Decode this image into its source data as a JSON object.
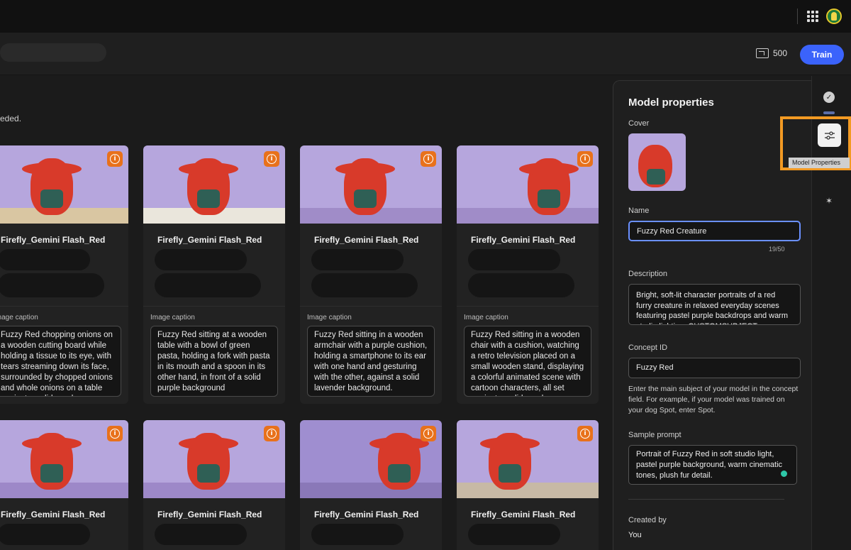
{
  "header": {
    "credits": "500",
    "train_label": "Train"
  },
  "main": {
    "intro_text": "eded.",
    "caption_label": "Image caption",
    "cards": [
      {
        "title": "Firefly_Gemini Flash_Red",
        "caption": "Fuzzy Red chopping onions on a wooden cutting board while holding a tissue to its eye, with tears streaming down its face, surrounded by chopped onions and whole onions on a table against a solid purple background"
      },
      {
        "title": "Firefly_Gemini Flash_Red",
        "caption": "Fuzzy Red sitting at a wooden table with a bowl of green pasta, holding a fork with pasta in its mouth and a spoon in its other hand, in front of a solid purple background"
      },
      {
        "title": "Firefly_Gemini Flash_Red",
        "caption": "Fuzzy Red sitting in a wooden armchair with a purple cushion, holding a smartphone to its ear with one hand and gesturing with the other, against a solid lavender background."
      },
      {
        "title": "Firefly_Gemini Flash_Red",
        "caption": "Fuzzy Red sitting in a wooden chair with a cushion, watching a retro television placed on a small wooden stand, displaying a colorful animated scene with cartoon characters, all set against a solid purple background"
      },
      {
        "title": "Firefly_Gemini Flash_Red",
        "caption": ""
      },
      {
        "title": "Firefly_Gemini Flash_Red",
        "caption": ""
      },
      {
        "title": "Firefly_Gemini Flash_Red",
        "caption": ""
      },
      {
        "title": "Firefly_Gemini Flash_Red",
        "caption": ""
      }
    ]
  },
  "panel": {
    "title": "Model properties",
    "cover_label": "Cover",
    "name_label": "Name",
    "name_value": "Fuzzy Red Creature",
    "name_counter": "19/50",
    "description_label": "Description",
    "description_value": "Bright, soft-lit character portraits of a red furry creature in relaxed everyday scenes featuring pastel purple backdrops and warm studio lighting. CUSTOMSUBJECT",
    "concept_label": "Concept ID",
    "concept_value": "Fuzzy Red",
    "concept_help": "Enter the main subject of your model in the concept field. For example, if your model was trained on your dog Spot, enter Spot.",
    "prompt_label": "Sample prompt",
    "prompt_value": "Portrait of Fuzzy Red in soft studio light, pastel purple background, warm cinematic tones, plush fur detail.",
    "created_label": "Created by",
    "created_value": "You"
  },
  "rail": {
    "tooltip": "Model Properties"
  },
  "colors": {
    "accent": "#3b63fb",
    "highlight": "#f29a23",
    "info_badge": "#e8711b",
    "backdrop": "#b6a6dd"
  }
}
